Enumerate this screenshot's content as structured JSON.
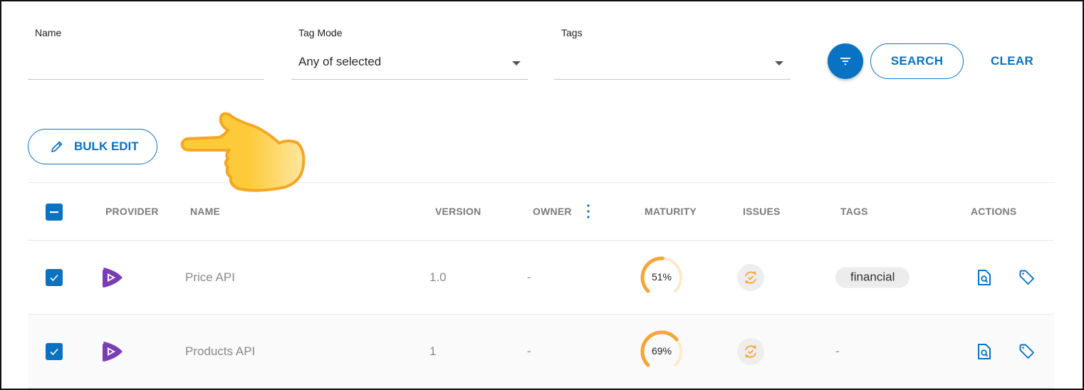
{
  "filters": {
    "name": {
      "label": "Name",
      "value": "",
      "placeholder": ""
    },
    "tag_mode": {
      "label": "Tag Mode",
      "value": "Any of selected"
    },
    "tags": {
      "label": "Tags",
      "value": ""
    },
    "filter_icon": "filter-icon",
    "search_label": "SEARCH",
    "clear_label": "CLEAR"
  },
  "toolbar": {
    "bulk_edit_label": "BULK EDIT",
    "bulk_edit_icon": "pencil-icon"
  },
  "overlay": {
    "pointer_icon": "pointing-hand-icon"
  },
  "table": {
    "select_all_state": "indeterminate",
    "columns": [
      "PROVIDER",
      "NAME",
      "VERSION",
      "OWNER",
      "MATURITY",
      "ISSUES",
      "TAGS",
      "ACTIONS"
    ],
    "rows": [
      {
        "selected": true,
        "provider_icon": "provider-logo-icon",
        "name": "Price API",
        "version": "1.0",
        "owner": "-",
        "maturity": 51,
        "maturity_label": "51%",
        "issues_icon": "sync-check-icon",
        "tags": [
          "financial"
        ],
        "tags_empty": ""
      },
      {
        "selected": true,
        "provider_icon": "provider-logo-icon",
        "name": "Products API",
        "version": "1",
        "owner": "-",
        "maturity": 69,
        "maturity_label": "69%",
        "issues_icon": "sync-check-icon",
        "tags": [],
        "tags_empty": "-"
      }
    ]
  },
  "colors": {
    "accent": "#0a72c2",
    "maturity": "#f7a534",
    "maturity_track": "#fde9cc",
    "provider": "#7b3db5"
  }
}
